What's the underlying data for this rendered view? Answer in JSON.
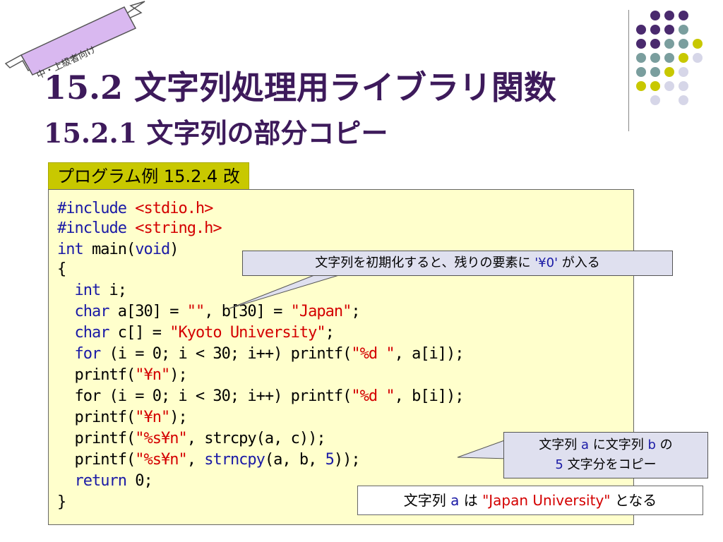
{
  "badge": "中・上級者向け",
  "title_main": "15.2 文字列処理用ライブラリ関数",
  "title_sub": "15.2.1 文字列の部分コピー",
  "example_label": "プログラム例 15.2.4 改",
  "code": {
    "l1a": "#include ",
    "l1b": "<stdio.h>",
    "l2a": "#include ",
    "l2b": "<string.h>",
    "l3a": "int",
    "l3b": " main(",
    "l3c": "void",
    "l3d": ")",
    "l4": "{",
    "l5a": "  int",
    "l5b": " i;",
    "l6a": "  char",
    "l6b": " a[30] = ",
    "l6c": "\"\"",
    "l6d": ", b[30] = ",
    "l6e": "\"Japan\"",
    "l6f": ";",
    "l7a": "  char",
    "l7b": " c[] = ",
    "l7c": "\"Kyoto University\"",
    "l7d": ";",
    "l8a": "  for",
    "l8b": " (i = 0; i < 30; i++) printf(",
    "l8c": "\"%d \"",
    "l8d": ", a[i]);",
    "l9a": "  printf(",
    "l9b": "\"¥n\"",
    "l9c": ");",
    "l10a": "  for (i = 0; i < 30; i++) printf(",
    "l10b": "\"%d \"",
    "l10c": ", b[i]);",
    "l11a": "  printf(",
    "l11b": "\"¥n\"",
    "l11c": ");",
    "l12a": "  printf(",
    "l12b": "\"%s¥n\"",
    "l12c": ", strcpy(a, c));",
    "l13a": "  printf(",
    "l13b": "\"%s¥n\"",
    "l13c": ", ",
    "l13d": "strncpy",
    "l13e": "(a, b, ",
    "l13f": "5",
    "l13g": "));",
    "l14a": "  return",
    "l14b": " 0;",
    "l15": "}"
  },
  "callout1": {
    "a": "文字列を初期化すると、残りの要素に ",
    "b": "'¥0'",
    "c": " が入る"
  },
  "callout2": {
    "a": "文字列 ",
    "b": "a",
    "c": " に文字列 ",
    "d": "b",
    "e": " の",
    "f": "5",
    "g": " 文字分をコピー"
  },
  "result": {
    "a": "文字列 ",
    "b": "a",
    "c": " は ",
    "d": "\"Japan University\"",
    "e": " となる"
  },
  "colors": {
    "title": "#3d1a5b",
    "label_bg": "#c8c800",
    "code_bg": "#ffffcc",
    "callout_bg": "#dfe0ef",
    "keyword": "#1a1aa6",
    "string": "#d40000"
  }
}
